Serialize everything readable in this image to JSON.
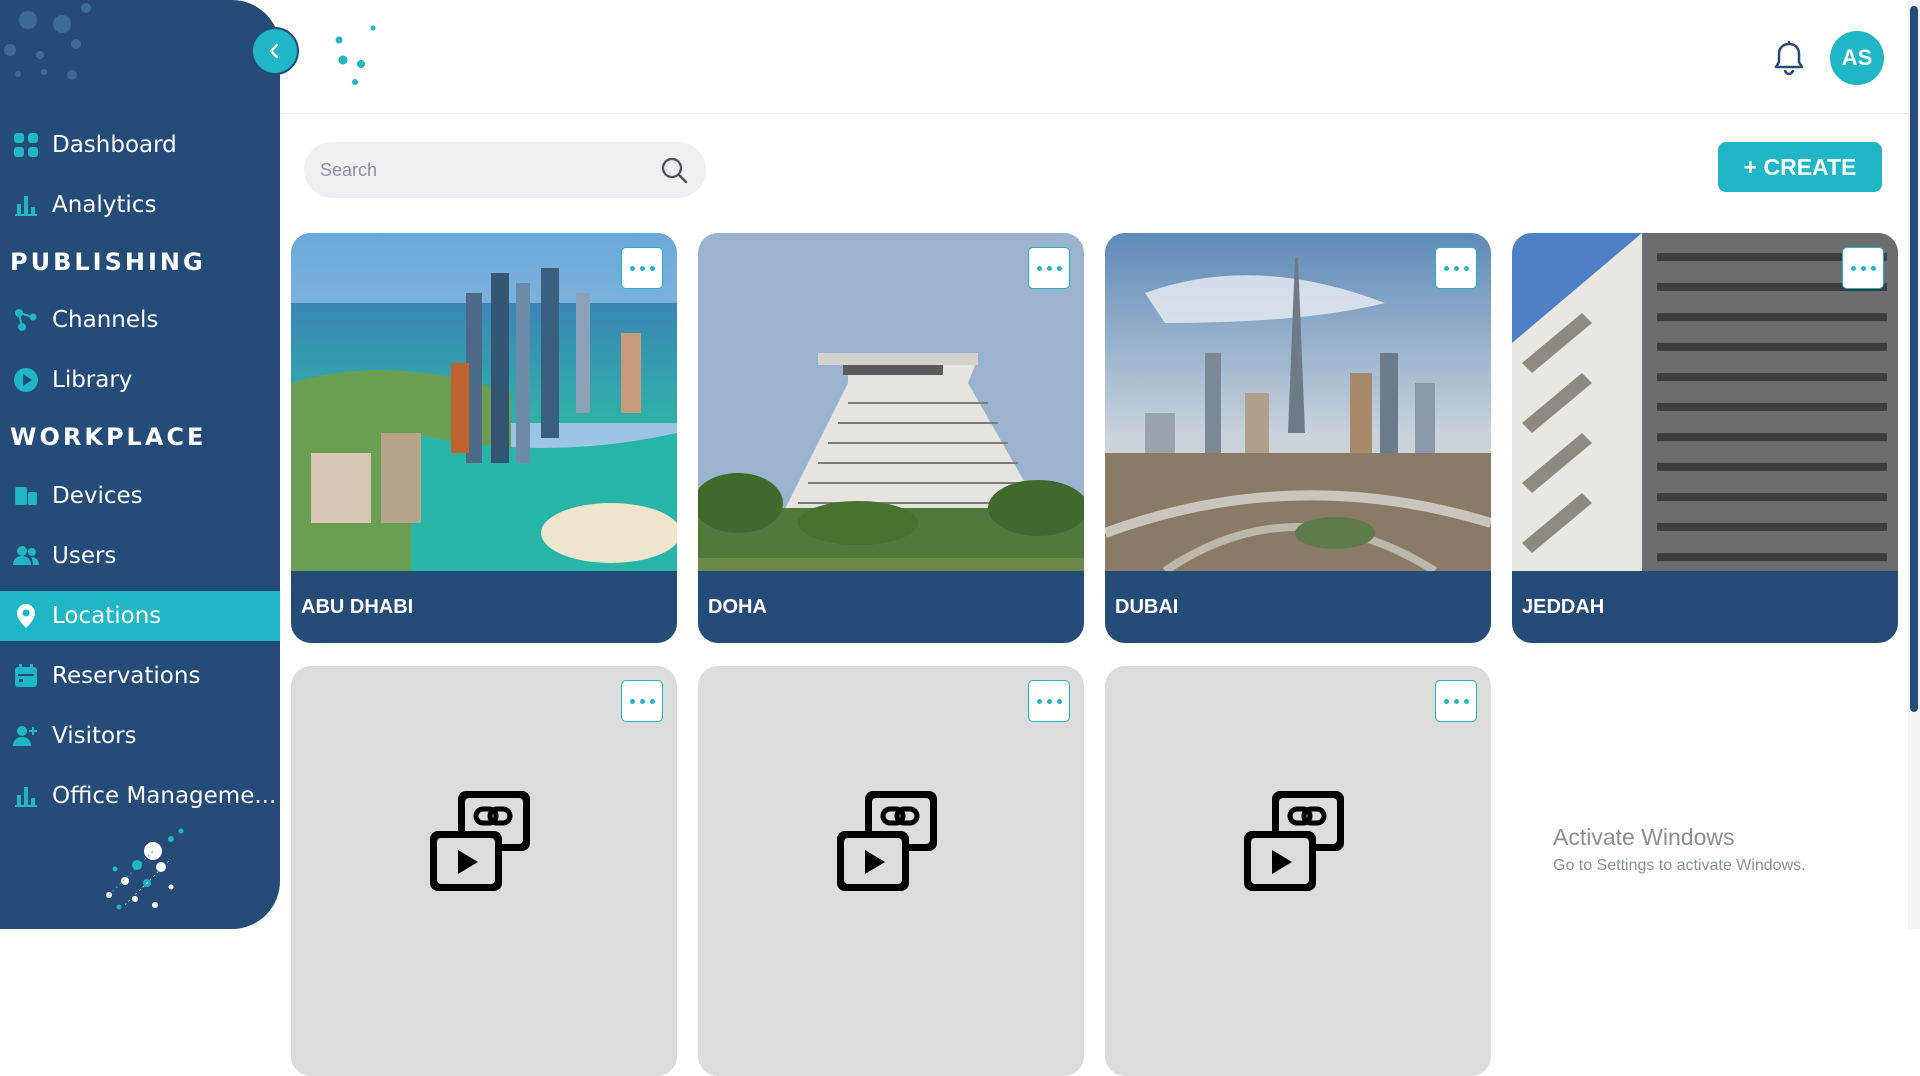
{
  "sidebar": {
    "sections": {
      "publishing": "PUBLISHING",
      "workplace": "WORKPLACE"
    },
    "items": [
      {
        "label": "Dashboard",
        "icon": "grid-icon"
      },
      {
        "label": "Analytics",
        "icon": "bar-chart-icon"
      },
      {
        "label": "Channels",
        "icon": "nodes-icon"
      },
      {
        "label": "Library",
        "icon": "play-circle-icon"
      },
      {
        "label": "Devices",
        "icon": "devices-icon"
      },
      {
        "label": "Users",
        "icon": "users-icon"
      },
      {
        "label": "Locations",
        "icon": "location-pin-icon",
        "active": true
      },
      {
        "label": "Reservations",
        "icon": "calendar-icon"
      },
      {
        "label": "Visitors",
        "icon": "user-plus-icon"
      },
      {
        "label": "Office Manageme..."
      }
    ]
  },
  "header": {
    "avatar_initials": "AS"
  },
  "toolbar": {
    "search_placeholder": "Search",
    "create_label": "+ CREATE"
  },
  "cards": [
    {
      "label": "ABU DHABI"
    },
    {
      "label": "DOHA"
    },
    {
      "label": "DUBAI"
    },
    {
      "label": "JEDDAH"
    },
    {
      "label": ""
    },
    {
      "label": ""
    },
    {
      "label": ""
    }
  ],
  "watermark": {
    "title": "Activate Windows",
    "subtitle": "Go to Settings to activate Windows."
  },
  "colors": {
    "sidebar": "#254b78",
    "accent": "#1fb6c6"
  }
}
